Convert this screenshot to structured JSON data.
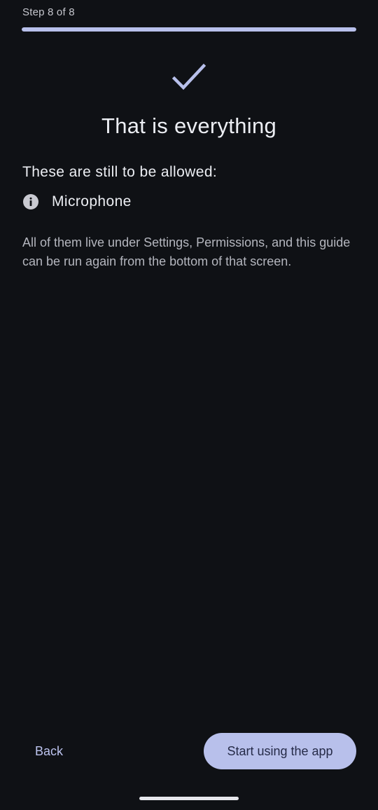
{
  "header": {
    "step_label": "Step 8 of 8",
    "progress": 1.0
  },
  "main": {
    "title": "That is everything",
    "pending_heading": "These are still to be allowed:",
    "permissions": [
      {
        "label": "Microphone",
        "icon": "info-icon"
      }
    ],
    "info_text": "All of them live under Settings, Permissions, and this guide can be run again from the bottom of that screen."
  },
  "footer": {
    "back_label": "Back",
    "start_label": "Start using the app"
  },
  "colors": {
    "background": "#0f1115",
    "accent": "#b8c0eb",
    "on_accent": "#262b48",
    "text_primary": "#eceef3",
    "text_secondary": "#b4b6be"
  }
}
